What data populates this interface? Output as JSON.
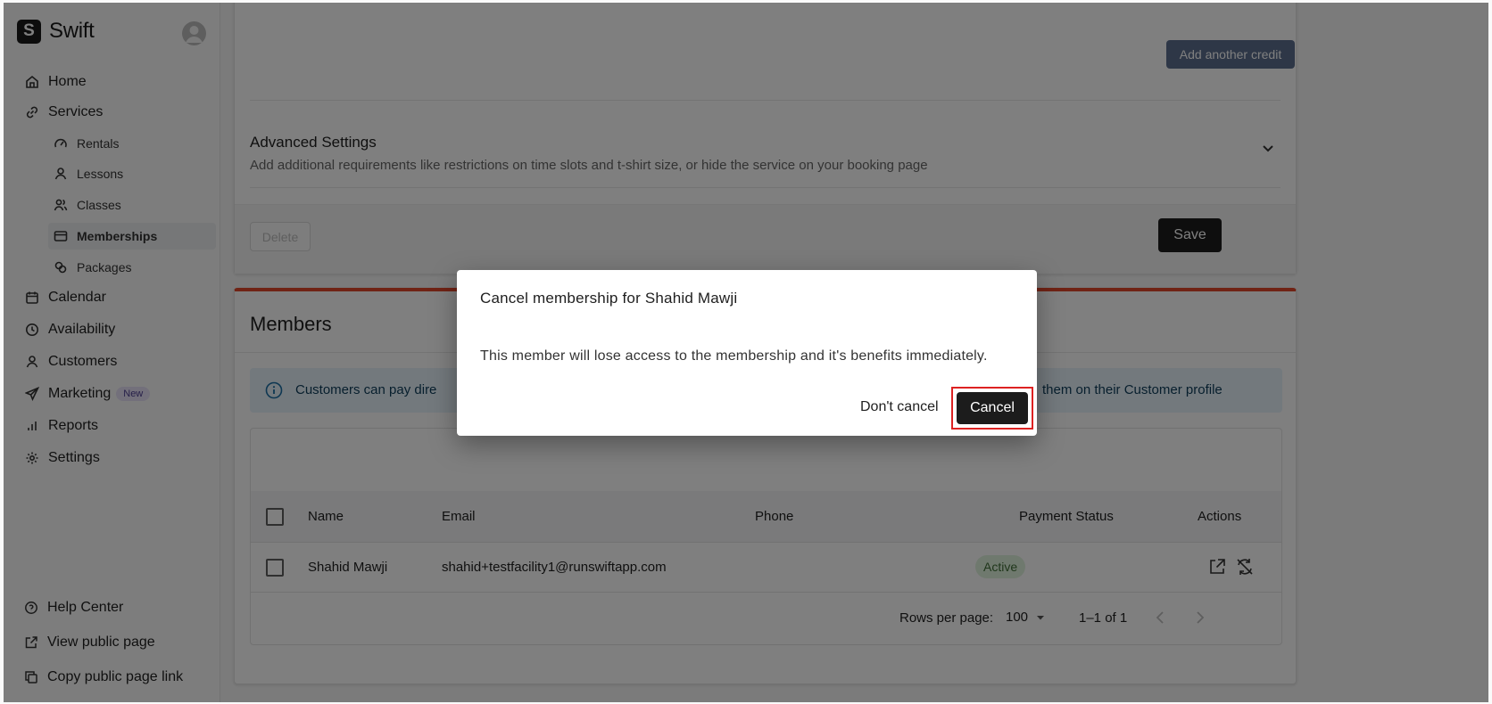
{
  "brand": {
    "name": "Swift",
    "logo_letter": "S"
  },
  "sidebar": {
    "items": [
      {
        "label": "Home",
        "icon": "home-icon"
      },
      {
        "label": "Services",
        "icon": "link-icon"
      },
      {
        "label": "Rentals",
        "icon": "gauge-icon"
      },
      {
        "label": "Lessons",
        "icon": "user-icon"
      },
      {
        "label": "Classes",
        "icon": "users-icon"
      },
      {
        "label": "Memberships",
        "icon": "card-icon"
      },
      {
        "label": "Packages",
        "icon": "package-icon"
      },
      {
        "label": "Calendar",
        "icon": "calendar-icon"
      },
      {
        "label": "Availability",
        "icon": "clock-icon"
      },
      {
        "label": "Customers",
        "icon": "user-icon"
      },
      {
        "label": "Marketing",
        "icon": "send-icon",
        "badge": "New"
      },
      {
        "label": "Reports",
        "icon": "bar-chart-icon"
      },
      {
        "label": "Settings",
        "icon": "gear-icon"
      }
    ],
    "bottom": [
      {
        "label": "Help Center",
        "icon": "help-icon"
      },
      {
        "label": "View public page",
        "icon": "external-link-icon"
      },
      {
        "label": "Copy public page link",
        "icon": "copy-icon"
      }
    ]
  },
  "service_form": {
    "add_credit_label": "Add another credit",
    "advanced_title": "Advanced Settings",
    "advanced_desc": "Add additional requirements like restrictions on time slots and t-shirt size, or hide the service on your booking page",
    "delete_label": "Delete",
    "save_label": "Save"
  },
  "members": {
    "title": "Members",
    "info_text_left": "Customers can pay dire",
    "info_text_right": "them on their Customer profile",
    "columns": [
      "Name",
      "Email",
      "Phone",
      "Payment Status",
      "Actions"
    ],
    "rows": [
      {
        "name": "Shahid Mawji",
        "email": "shahid+testfacility1@runswiftapp.com",
        "phone": "",
        "status": "Active"
      }
    ],
    "pager": {
      "rows_per_page_label": "Rows per page:",
      "rows_per_page": "100",
      "range": "1–1 of 1"
    }
  },
  "dialog": {
    "title": "Cancel membership for Shahid Mawji",
    "body": "This member will lose access to the membership and it's benefits immediately.",
    "dont_cancel_label": "Don't cancel",
    "cancel_label": "Cancel"
  },
  "colors": {
    "accent_red": "#e0472a",
    "primary_dark": "#1c1c1c",
    "status_active": "#dff2dc",
    "highlight_border": "#dd2222"
  }
}
